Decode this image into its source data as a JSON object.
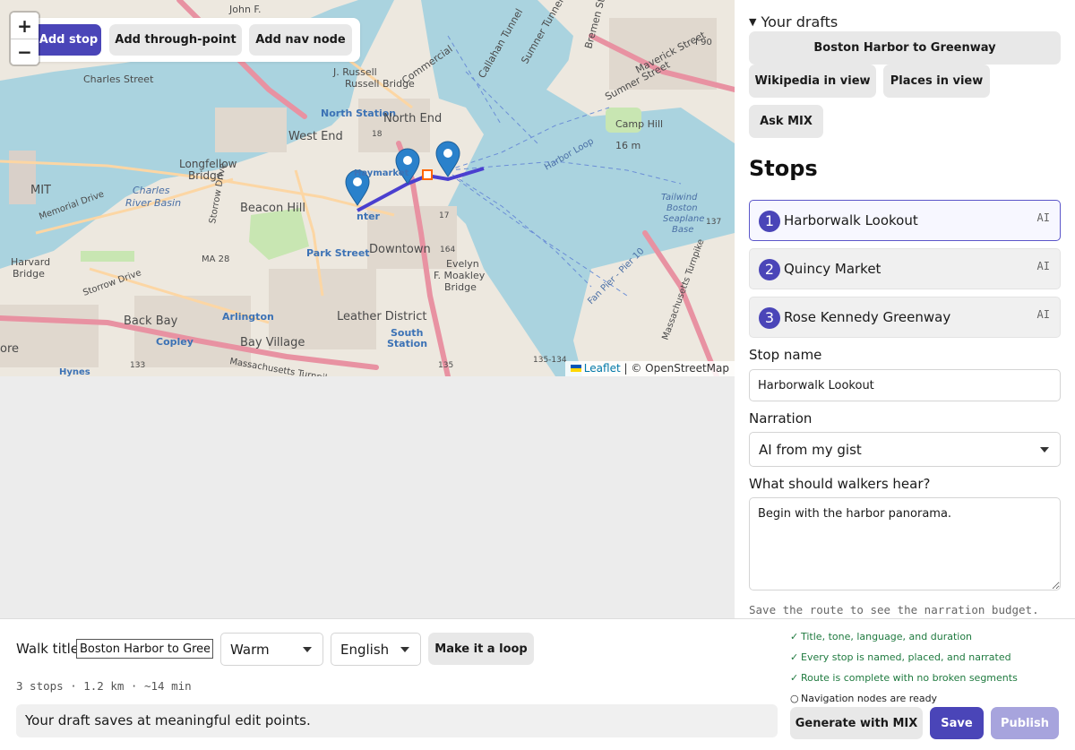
{
  "map": {
    "zoom_in": "+",
    "zoom_out": "−",
    "tools": {
      "add_stop": "Add stop",
      "add_through_point": "Add through-point",
      "add_nav_node": "Add nav node"
    },
    "attribution": {
      "leaflet": "Leaflet",
      "separator": " | © ",
      "osm": "OpenStreetMap"
    },
    "labels": {
      "john_f": "John F.",
      "i90": "I 90",
      "charles_street": "Charles Street",
      "russell_bridge": "Russell Bridge",
      "j_russell": "J. Russell",
      "commercial": "Commercial",
      "callahan": "Callahan Tunnel",
      "sumner_tunnel": "Sumner Tunnel",
      "bremen": "Bremen Street",
      "maverick": "Maverick Street",
      "sumner_street": "Sumner Street",
      "north_station": "North Station",
      "north_end": "North End",
      "west_end": "West End",
      "camp_hill": "Camp Hill",
      "camp_hill_elev": "16 m",
      "longfellow": "Longfellow",
      "bridge": "Bridge",
      "haymarket": "Haymarket",
      "mit": "MIT",
      "charles_river_basin_1": "Charles",
      "charles_river_basin_2": "River Basin",
      "memorial_drive": "Memorial Drive",
      "beacon_hill": "Beacon Hill",
      "storrow": "Storrow Drive",
      "downtown": "Downtown",
      "park_street": "Park Street",
      "ma28": "MA 28",
      "harvard_bridge_1": "Harvard",
      "harvard_bridge_2": "Bridge",
      "storrow_drive2": "Storrow Drive",
      "back_bay": "Back Bay",
      "arlington": "Arlington",
      "bay_village": "Bay Village",
      "leather_district": "Leather District",
      "south_station_1": "South",
      "south_station_2": "Station",
      "evelyn_1": "Evelyn",
      "evelyn_2": "F. Moakley",
      "evelyn_3": "Bridge",
      "copley": "Copley",
      "hynes": "Hynes",
      "mass_pike": "Massachusetts Turnpike",
      "mass_pike_2": "Massachusetts Turnpike",
      "num_133": "133",
      "num_135": "135",
      "num_135b": "135-134",
      "num_137": "137",
      "num_18": "18",
      "num_17": "17",
      "num_164": "164",
      "tailwind_1": "Tailwind",
      "tailwind_2": "Boston",
      "tailwind_3": "Seaplane",
      "tailwind_4": "Base",
      "fan_pier": "Fan Pier - Pier 10",
      "harbor_loop": "Harbor Loop",
      "center": "nter",
      "ore": "ore"
    }
  },
  "panel": {
    "drafts_label": "Your drafts",
    "draft_button": "Boston Harbor to Greenway",
    "wikipedia_button": "Wikipedia in view",
    "places_button": "Places in view",
    "ask_button": "Ask MIX",
    "stops_title": "Stops",
    "stops": [
      {
        "number": "1",
        "name": "Harborwalk Lookout",
        "badge": "AI"
      },
      {
        "number": "2",
        "name": "Quincy Market",
        "badge": "AI"
      },
      {
        "number": "3",
        "name": "Rose Kennedy Greenway",
        "badge": "AI"
      }
    ],
    "stop_name_label": "Stop name",
    "stop_name_value": "Harborwalk Lookout",
    "narration_label": "Narration",
    "narration_value": "AI from my gist",
    "hear_label": "What should walkers hear?",
    "hear_value": "Begin with the harbor panorama.",
    "budget_note": "Save the route to see the narration budget."
  },
  "bottom": {
    "walk_title_label": "Walk title",
    "walk_title_value": "Boston Harbor to Greenway",
    "tone_value": "Warm",
    "language_value": "English",
    "loop_button": "Make it a loop",
    "stats": "3 stops · 1.2 km · ~14 min",
    "save_message": "Your draft saves at meaningful edit points.",
    "checklist": [
      {
        "mark": "✓",
        "text": "Title, tone, language, and duration",
        "status": "done"
      },
      {
        "mark": "✓",
        "text": "Every stop is named, placed, and narrated",
        "status": "done"
      },
      {
        "mark": "✓",
        "text": "Route is complete with no broken segments",
        "status": "done"
      },
      {
        "mark": "○",
        "text": "Navigation nodes are ready",
        "status": "pending"
      }
    ],
    "generate_button": "Generate with MIX",
    "save_button": "Save",
    "publish_button": "Publish"
  },
  "colors": {
    "accent": "#4a45b8",
    "publish_disabled": "#a7a4dd",
    "check_done": "#1f7a3f",
    "route": "#4a3fcf",
    "marker": "#2a81cb"
  }
}
